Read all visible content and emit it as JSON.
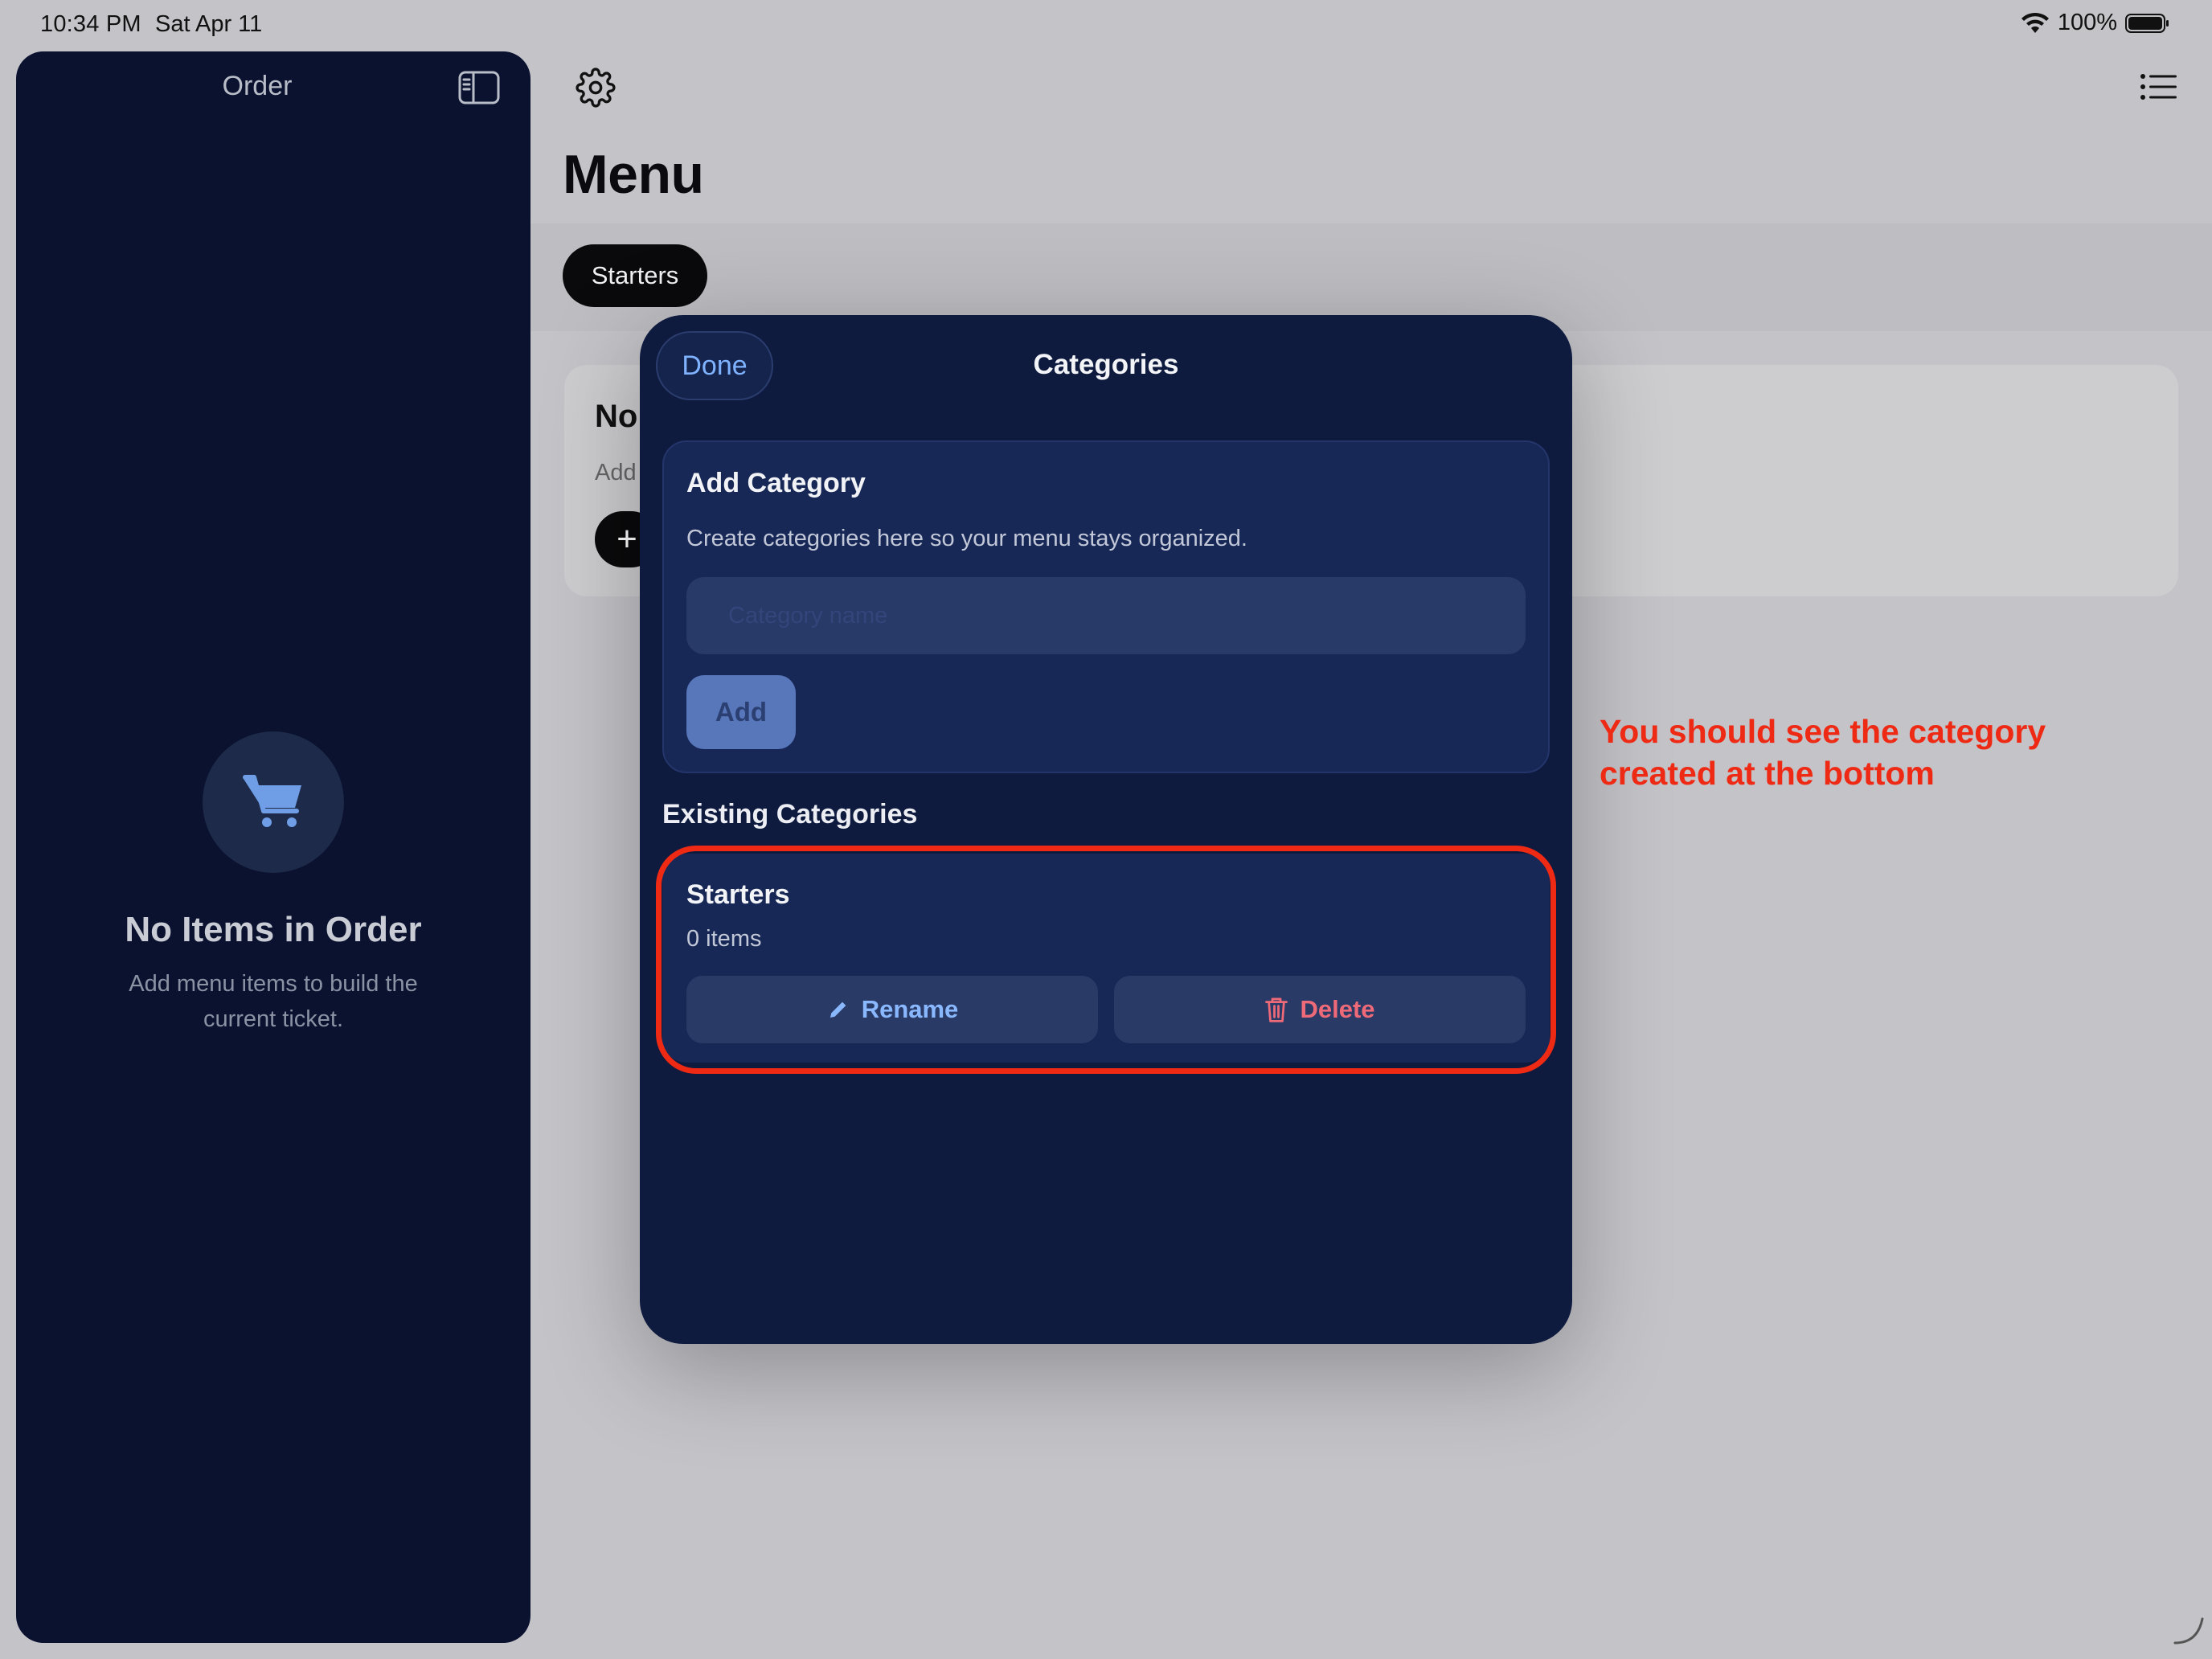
{
  "status_bar": {
    "time": "10:34 PM",
    "date": "Sat Apr 11",
    "battery": "100%"
  },
  "sidebar": {
    "title": "Order",
    "empty_title": "No Items in Order",
    "empty_subtitle": "Add menu items to build the current ticket."
  },
  "main": {
    "title": "Menu",
    "category_chip": "Starters",
    "card_title_fragment": "No",
    "card_sub_fragment": "Add",
    "card_button_fragment": "+"
  },
  "modal": {
    "done_label": "Done",
    "title": "Categories",
    "add_section": {
      "title": "Add Category",
      "description": "Create categories here so your menu stays organized.",
      "input_value": "",
      "input_placeholder": "Category name",
      "add_label": "Add"
    },
    "existing_label": "Existing Categories",
    "categories": [
      {
        "name": "Starters",
        "count": "0 items",
        "rename_label": "Rename",
        "delete_label": "Delete"
      }
    ]
  },
  "annotation": {
    "text": "You should see the category created at the bottom",
    "color": "#ee2a15"
  },
  "colors": {
    "sidebar_bg": "#0a1230",
    "modal_bg": "#0e1a3e",
    "accent_blue": "#7fb2ff",
    "delete_red": "#ef6a78"
  }
}
